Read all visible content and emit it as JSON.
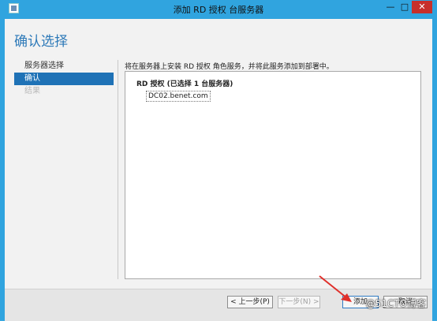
{
  "window": {
    "title": "添加 RD 授权 台服务器",
    "controls": {
      "min": "—",
      "max": "□",
      "close": "✕"
    }
  },
  "page": {
    "heading": "确认选择"
  },
  "nav": {
    "items": [
      {
        "label": "服务器选择",
        "state": "normal"
      },
      {
        "label": "确认",
        "state": "active"
      },
      {
        "label": "结果",
        "state": "disabled"
      }
    ]
  },
  "main": {
    "description": "将在服务器上安装 RD 授权 角色服务，并将此服务添加到部署中。",
    "panel_heading": "RD 授权 (已选择 1 台服务器)",
    "server": "DC02.benet.com"
  },
  "footer": {
    "prev": "< 上一步(P)",
    "next": "下一步(N) >",
    "install": "添加",
    "cancel": "取消"
  },
  "watermark": "@51CTO博客",
  "colors": {
    "accent": "#30a4df",
    "heading": "#2d79b8",
    "active_nav": "#1f72b6",
    "arrow": "#e0302b"
  }
}
